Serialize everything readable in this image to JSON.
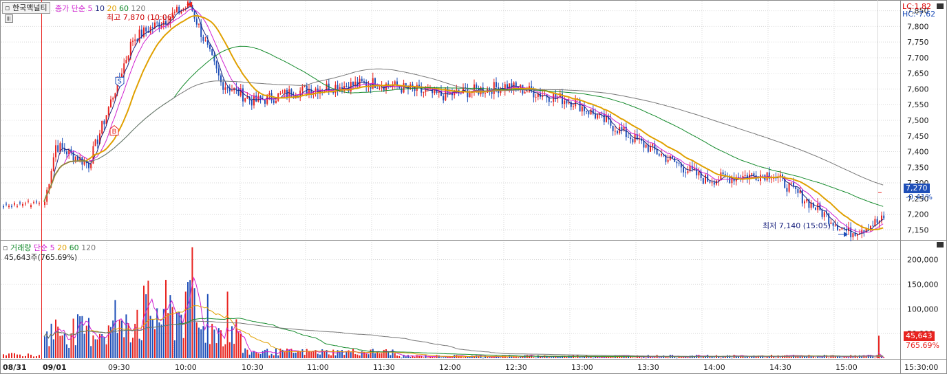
{
  "header": {
    "stock_name": "한국맥널티",
    "price_legend": {
      "label": "종가 단순",
      "periods": [
        "5",
        "10",
        "20",
        "60",
        "120"
      ]
    },
    "high_annotation": "최고 7,870 (10:06)",
    "low_annotation": "최저 7,140 (15:05)",
    "lc": "LC:1.82",
    "hc": "HC:-7.62"
  },
  "volume_panel": {
    "legend_label": "거래량",
    "ma_label": "단순",
    "periods": [
      "5",
      "20",
      "60",
      "120"
    ],
    "current": "45,643주(765.69%)",
    "tag_value": "45,643",
    "tag_pct": "765.69%"
  },
  "price_axis": {
    "ticks": [
      "7,850",
      "7,800",
      "7,750",
      "7,700",
      "7,650",
      "7,600",
      "7,550",
      "7,500",
      "7,450",
      "7,400",
      "7,350",
      "7,300",
      "7,250",
      "7,200",
      "7,150"
    ],
    "current_price": "7,270",
    "current_change": "-0.41%"
  },
  "volume_axis": {
    "ticks": [
      "200,000",
      "150,000",
      "100,000",
      "50,000"
    ]
  },
  "time_axis": {
    "ticks": [
      "08/31",
      "09/01",
      "09:30",
      "10:00",
      "10:30",
      "11:00",
      "11:30",
      "12:00",
      "12:30",
      "13:00",
      "13:30",
      "14:00",
      "14:30",
      "15:00",
      "15:30:00"
    ]
  },
  "markers": {
    "sell": "S",
    "buy": "B"
  },
  "colors": {
    "up": "#e8231f",
    "down": "#1f4fb8",
    "ma5": "#1a237e",
    "ma10": "#d01fd0",
    "ma20": "#e0a000",
    "ma60": "#138a2b",
    "ma120": "#777777",
    "grid": "#d8d8d8"
  },
  "chart_data": {
    "type": "candlestick",
    "interval": "1min",
    "price_range": [
      7120,
      7880
    ],
    "high": 7870,
    "low": 7140,
    "last": 7270,
    "key_points": [
      {
        "t": "09:00",
        "price": 7240
      },
      {
        "t": "09:05",
        "price": 7420
      },
      {
        "t": "09:20",
        "price": 7360
      },
      {
        "t": "09:30",
        "price": 7560
      },
      {
        "t": "09:40",
        "price": 7760
      },
      {
        "t": "10:06",
        "price": 7870
      },
      {
        "t": "10:20",
        "price": 7620
      },
      {
        "t": "10:35",
        "price": 7560
      },
      {
        "t": "11:00",
        "price": 7600
      },
      {
        "t": "11:30",
        "price": 7620
      },
      {
        "t": "12:00",
        "price": 7580
      },
      {
        "t": "12:30",
        "price": 7610
      },
      {
        "t": "13:00",
        "price": 7560
      },
      {
        "t": "13:30",
        "price": 7430
      },
      {
        "t": "14:00",
        "price": 7310
      },
      {
        "t": "14:30",
        "price": 7330
      },
      {
        "t": "15:05",
        "price": 7140
      },
      {
        "t": "15:20",
        "price": 7180
      }
    ]
  }
}
